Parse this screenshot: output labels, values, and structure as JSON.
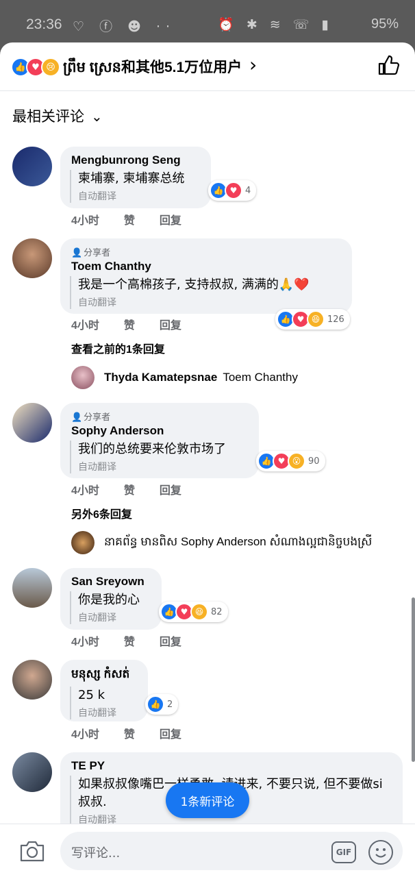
{
  "status_bar": {
    "time": "23:36",
    "battery": "95%"
  },
  "header": {
    "title": "ព្រឹម ស្រេន和其他5.1万位用户"
  },
  "sort": {
    "label": "最相关评论"
  },
  "labels": {
    "time": "4小时",
    "like": "赞",
    "reply": "回复",
    "auto_translate": "自动翻译",
    "sharer": "分享者"
  },
  "comments": [
    {
      "author": "Mengbunrong Seng",
      "text": "柬埔寨, 柬埔寨总统",
      "reaction_count": "4"
    },
    {
      "author": "Toem Chanthy",
      "text": "我是一个高棉孩子, 支持叔叔, 满满的🙏❤️",
      "reaction_count": "126",
      "view_replies": "查看之前的1条回复",
      "reply": {
        "name": "Thyda Kamatepsnae",
        "text": "Toem Chanthy"
      }
    },
    {
      "author": "Sophy Anderson",
      "text": "我们的总统要来伦敦市场了",
      "reaction_count": "90",
      "view_replies": "另外6条回复",
      "reply": {
        "name": "",
        "text": "នាគព័ន្ធ មានពិស Sophy Anderson សំណាងល្អជានិច្ចបងស្រី"
      }
    },
    {
      "author": "San Sreyown",
      "text": "你是我的心",
      "reaction_count": "82"
    },
    {
      "author": "មនុស្ស កំសត់",
      "text": "25 k",
      "reaction_count": "2"
    },
    {
      "author": "TE PY",
      "text": "如果叔叔像嘴巴一样勇敢, 请进来, 不要只说, 但不要做si叔叔."
    }
  ],
  "new_comment_button": "1条新评论",
  "composer": {
    "placeholder": "写评论...",
    "gif": "GIF"
  },
  "colors": {
    "accent": "#1877f2",
    "love": "#f33e58",
    "bubble": "#f0f2f5"
  }
}
